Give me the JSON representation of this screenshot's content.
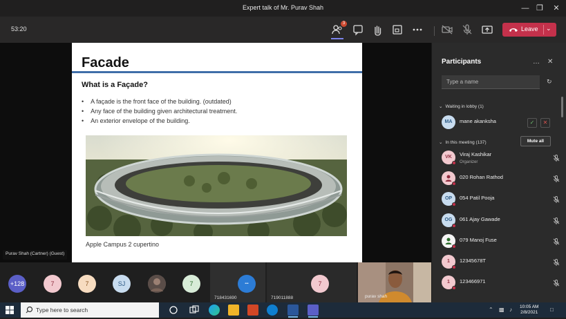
{
  "window": {
    "title": "Expert talk of Mr. Purav Shah"
  },
  "toolbar": {
    "timer": "53:20",
    "participants_count_badge": "3",
    "leave_label": "Leave",
    "leave_color": "#c4314b",
    "icons": [
      "people-icon",
      "chat-icon",
      "raise-hand-icon",
      "rooms-icon",
      "more-icon",
      "camera-off-icon",
      "mic-off-icon",
      "share-icon"
    ]
  },
  "slide": {
    "title": "Facade",
    "subtitle": "What is a Façade?",
    "bullets": [
      "A façade is the front face of the building. (outdated)",
      "Any face of the building given architectural treatment.",
      "An exterior envelope of the building."
    ],
    "caption": "Apple Campus 2 cupertino",
    "accent_color": "#3f6ea8"
  },
  "presenter": {
    "label": "Purav Shah (Cartner) (Guest)"
  },
  "strip": {
    "overflow": "+128",
    "avatars": [
      "7",
      "7",
      "SJ",
      "7"
    ],
    "tiles": [
      {
        "number": "718431690"
      },
      {
        "number": "719011888",
        "avatar": "7"
      }
    ],
    "camera_name": "purav shah"
  },
  "panel": {
    "title": "Participants",
    "search_placeholder": "Type a name",
    "lobby_heading": "Waiting in lobby (1)",
    "lobby": [
      {
        "initials": "MA",
        "name": "mane akanksha"
      }
    ],
    "meeting_heading": "In this meeting (137)",
    "mute_all_label": "Mute all",
    "participants": [
      {
        "initials": "VK",
        "name": "Viraj Kashikar",
        "role": "Organizer",
        "color": "#f2c9cf",
        "text_color": "#8e2c3e"
      },
      {
        "initials": "",
        "name": "020 Rohan Rathod",
        "role": "",
        "color": "#f2c9cf",
        "text_color": "#8e2c3e"
      },
      {
        "initials": "OP",
        "name": "054 Patil Pooja",
        "role": "",
        "color": "#c8dcef",
        "text_color": "#2e5b86"
      },
      {
        "initials": "OG",
        "name": "061 Ajay Gawade",
        "role": "",
        "color": "#c8dcef",
        "text_color": "#2e5b86"
      },
      {
        "initials": "",
        "name": "079 Manoj Fuse",
        "role": "",
        "color": "#f5f5f5",
        "text_color": "#2b6b2b"
      },
      {
        "initials": "1",
        "name": "12345678T",
        "role": "",
        "color": "#f2c9cf",
        "text_color": "#8e2c3e"
      },
      {
        "initials": "1",
        "name": "123466971",
        "role": "",
        "color": "#f2c9cf",
        "text_color": "#8e2c3e"
      }
    ]
  },
  "taskbar": {
    "search_placeholder": "Type here to search",
    "time": "10:05 AM",
    "date": "2/8/2021"
  }
}
